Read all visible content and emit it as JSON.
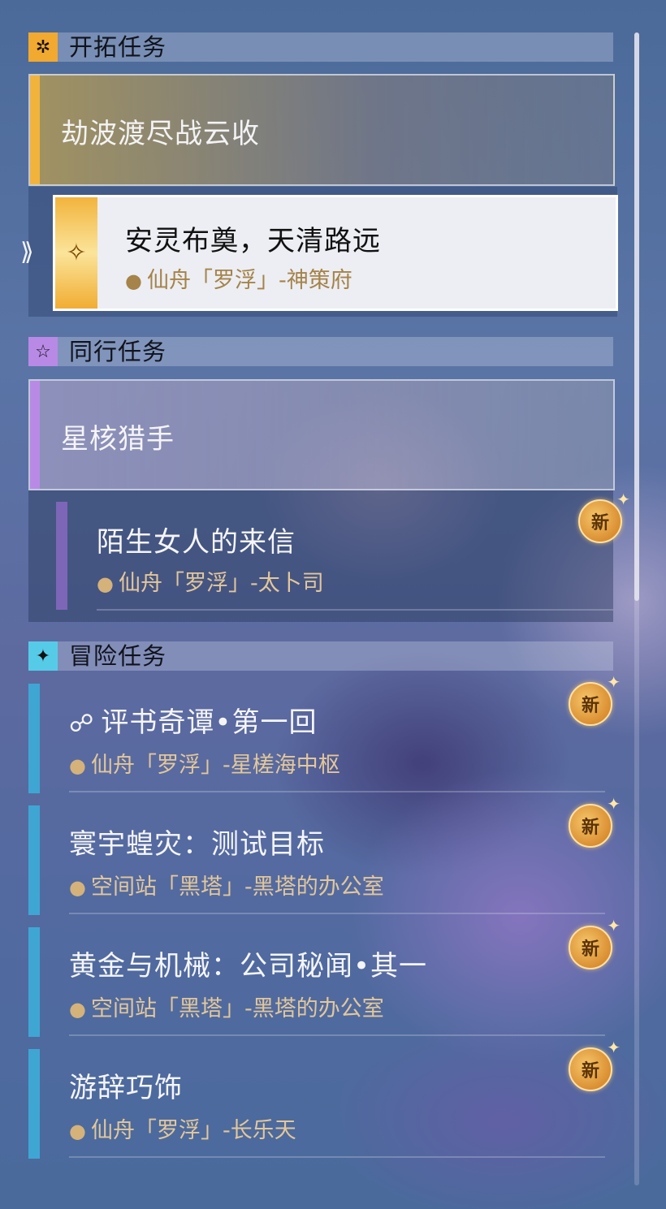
{
  "sections": {
    "trailblaze": {
      "title": "开拓任务",
      "icon": "trailblaze-emblem-icon",
      "color": "#f2a92f",
      "card": {
        "title": "劫波渡尽战云收"
      },
      "selected_quest": {
        "title": "安灵布奠，天清路远",
        "location": "仙舟「罗浮」-神策府"
      }
    },
    "companion": {
      "title": "同行任务",
      "icon": "star-icon",
      "color": "#b88ae6",
      "card": {
        "title": "星核猎手"
      },
      "quest": {
        "title": "陌生女人的来信",
        "location": "仙舟「罗浮」-太卜司",
        "badge": "新"
      }
    },
    "adventure": {
      "title": "冒险任务",
      "icon": "sparkle-icon",
      "color": "#56cbe8",
      "quests": [
        {
          "title": "评书奇谭•第一回",
          "location": "仙舟「罗浮」-星槎海中枢",
          "badge": "新",
          "icon": "event-icon"
        },
        {
          "title": "寰宇蝗灾：测试目标",
          "location": "空间站「黑塔」-黑塔的办公室",
          "badge": "新"
        },
        {
          "title": "黄金与机械：公司秘闻•其一",
          "location": "空间站「黑塔」-黑塔的办公室",
          "badge": "新"
        },
        {
          "title": "游辞巧饰",
          "location": "仙舟「罗浮」-长乐天",
          "badge": "新"
        }
      ]
    }
  }
}
